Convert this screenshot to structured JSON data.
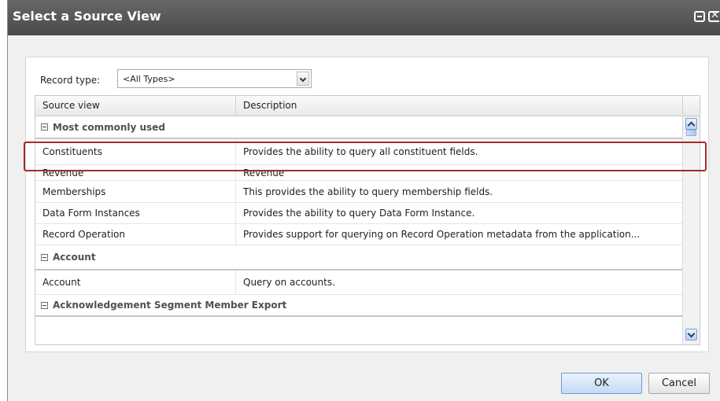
{
  "dialog": {
    "title": "Select a Source View",
    "minimize_icon": "minimize-icon",
    "close_icon": "close-icon"
  },
  "record_type": {
    "label": "Record type:",
    "value": "<All Types>"
  },
  "grid": {
    "columns": [
      "Source view",
      "Description"
    ],
    "groups": [
      {
        "name": "Most commonly used",
        "rows": [
          {
            "source": "Constituents",
            "description": "Provides the ability to query all constituent fields."
          },
          {
            "source": "Revenue",
            "description": "Revenue"
          },
          {
            "source": "Memberships",
            "description": "This provides the ability to query membership fields."
          },
          {
            "source": "Data Form Instances",
            "description": "Provides the ability to query Data Form Instance."
          },
          {
            "source": "Record Operation",
            "description": "Provides support for querying on Record Operation metadata from the application..."
          }
        ]
      },
      {
        "name": "Account",
        "rows": [
          {
            "source": "Account",
            "description": "Query on accounts."
          }
        ]
      },
      {
        "name": "Acknowledgement Segment Member Export",
        "rows": []
      }
    ]
  },
  "highlight": {
    "color": "#a52a2a"
  },
  "buttons": {
    "ok": "OK",
    "cancel": "Cancel"
  }
}
